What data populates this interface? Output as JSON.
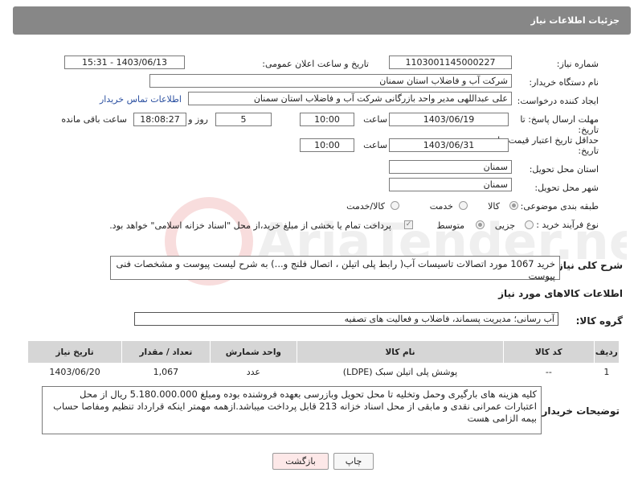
{
  "header": {
    "title": "جزئیات اطلاعات نیاز"
  },
  "form": {
    "need_number_label": "شماره نیاز:",
    "need_number": "1103001145000227",
    "announce_label": "تاریخ و ساعت اعلان عمومی:",
    "announce_value": "1403/06/13 - 15:31",
    "buyer_org_label": "نام دستگاه خریدار:",
    "buyer_org": "شرکت آب و فاضلاب استان سمنان",
    "creator_label": "ایجاد کننده درخواست:",
    "creator": "علی عبداللهی مدیر واحد بازرگانی شرکت آب و فاضلاب استان سمنان",
    "contact_link": "اطلاعات تماس خریدار",
    "deadline_label": "مهلت ارسال پاسخ: تا",
    "deadline_label2": "تاریخ:",
    "deadline_date": "1403/06/19",
    "time_label": "ساعت",
    "deadline_time": "10:00",
    "days_value": "5",
    "days_label": "روز و",
    "remaining_time": "18:08:27",
    "remaining_label": "ساعت باقی مانده",
    "validity_label": "حداقل تاریخ اعتبار قیمت: تا",
    "validity_label2": "تاریخ:",
    "validity_date": "1403/06/31",
    "validity_time": "10:00",
    "province_label": "استان محل تحویل:",
    "province": "سمنان",
    "city_label": "شهر محل تحویل:",
    "city": "سمنان",
    "category_label": "طبقه بندی موضوعی:",
    "category_options": [
      "کالا",
      "خدمت",
      "کالا/خدمت"
    ],
    "purchase_type_label": "نوع فرآیند خرید :",
    "purchase_options": [
      "جزیی",
      "متوسط"
    ],
    "payment_note": "پرداخت تمام یا بخشی از مبلغ خرید،از محل \"اسناد خزانه اسلامی\" خواهد بود."
  },
  "description": {
    "label": "شرح کلی نیاز:",
    "text": "خرید 1067 مورد اتصالات تاسیسات آب( رابط پلی اتیلن ، اتصال فلنج و...) به شرح لیست پیوست و مشخصات فنی پیوست"
  },
  "goods": {
    "section_title": "اطلاعات کالاهای مورد نیاز",
    "group_label": "گروه کالا:",
    "group_value": "آب رسانی؛ مدیریت پسماند، فاضلاب و فعالیت های تصفیه",
    "columns": [
      "ردیف",
      "کد کالا",
      "نام کالا",
      "واحد شمارش",
      "تعداد / مقدار",
      "تاریخ نیاز"
    ],
    "rows": [
      {
        "row": "1",
        "code": "--",
        "name": "پوشش پلی اتیلن سبک (LDPE)",
        "unit": "عدد",
        "qty": "1,067",
        "date": "1403/06/20"
      }
    ]
  },
  "buyer_notes": {
    "label": "توضیحات خریدار:",
    "text": "کلیه هزینه های بارگیری وحمل وتخلیه تا محل تحویل وبازرسی بعهده فروشنده بوده ومبلغ 5.180.000.000 ریال از محل اعتبارات عمرانی  نقدی و مابقی از محل  اسناد خزانه 213 قابل پرداخت میباشد.ازهمه مهمتر اینکه قرارداد تنظیم ومفاصا حساب بیمه الزامی هست"
  },
  "buttons": {
    "print": "چاپ",
    "back": "بازگشت"
  },
  "colors": {
    "header_bg": "#878787",
    "back_button_bg": "#fde8e8",
    "link": "#2a4fa0"
  },
  "watermark_text": "AriaTender.neT"
}
